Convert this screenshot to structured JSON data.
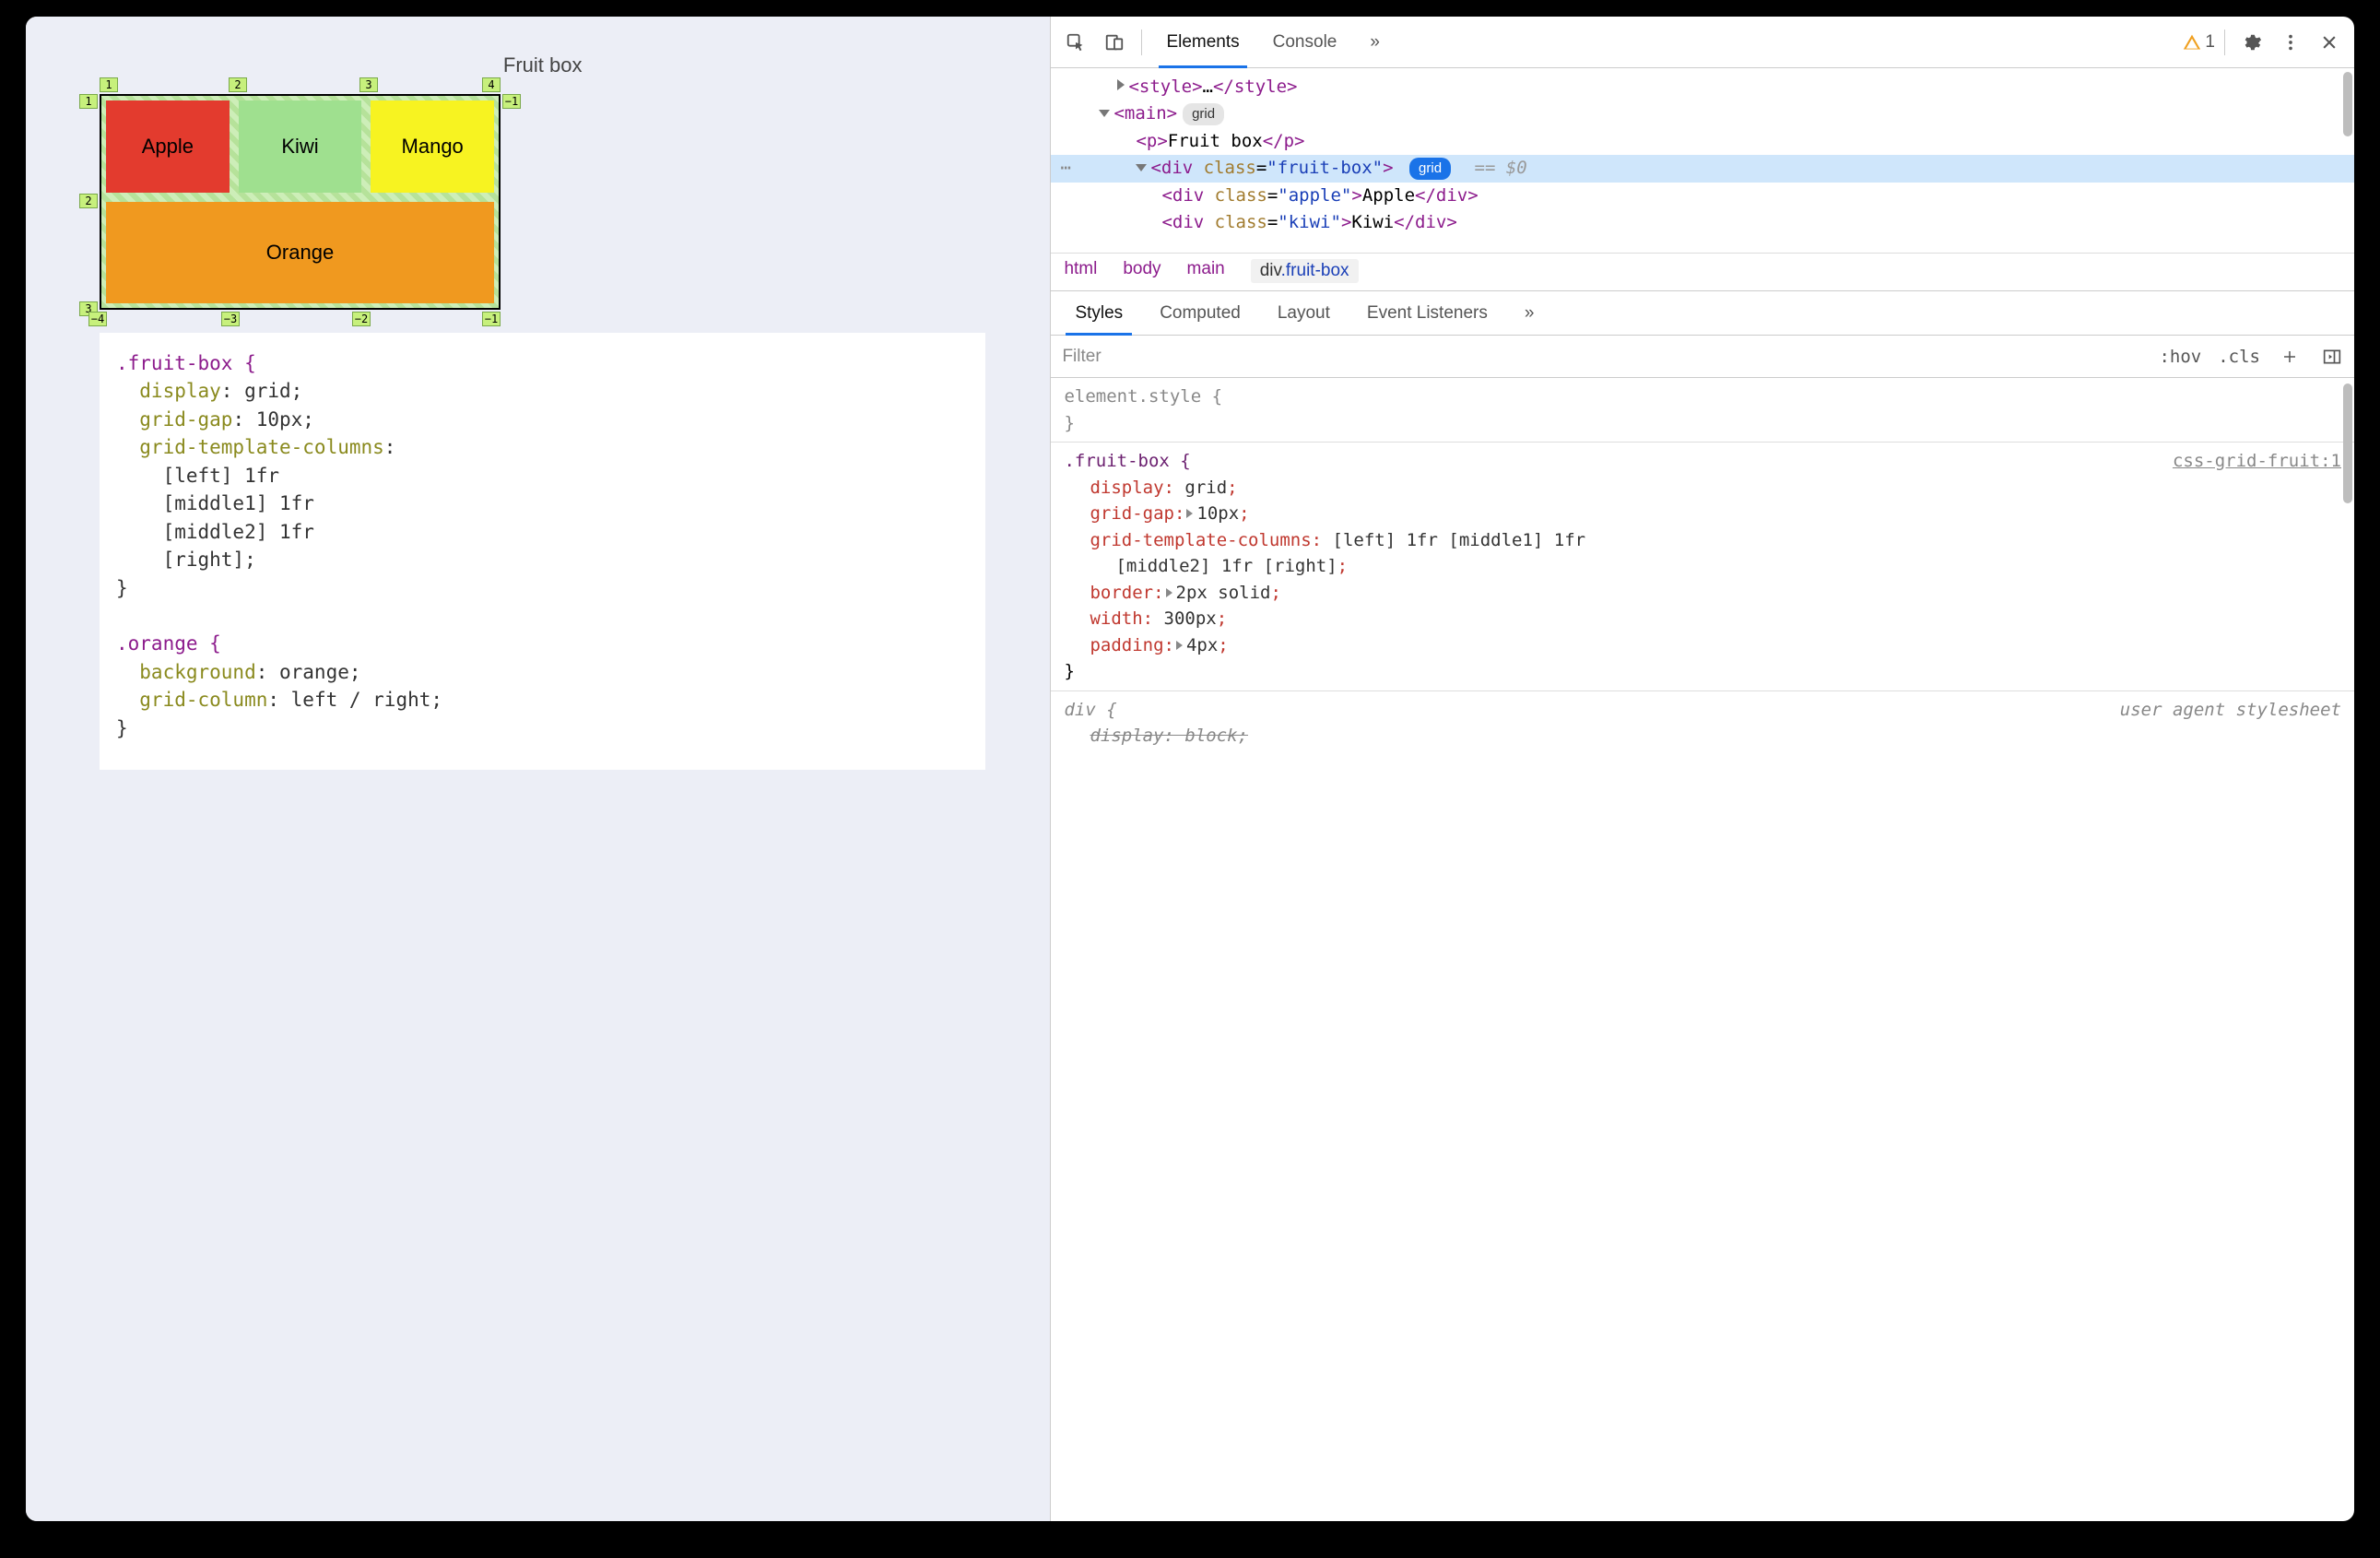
{
  "page": {
    "title": "Fruit box",
    "cells": {
      "apple": "Apple",
      "kiwi": "Kiwi",
      "mango": "Mango",
      "orange": "Orange"
    },
    "grid_labels": {
      "top": [
        "1",
        "2",
        "3",
        "4"
      ],
      "left": [
        "1",
        "2",
        "3"
      ],
      "right_neg": "−1",
      "bottom_neg": [
        "−4",
        "−3",
        "−2",
        "−1"
      ]
    }
  },
  "snippet": {
    "rule1_selector": ".fruit-box {",
    "rule1_lines": [
      "  display: grid;",
      "  grid-gap: 10px;",
      "  grid-template-columns:",
      "    [left] 1fr",
      "    [middle1] 1fr",
      "    [middle2] 1fr",
      "    [right];",
      "}"
    ],
    "rule2_selector": ".orange {",
    "rule2_lines": [
      "  background: orange;",
      "  grid-column: left / right;",
      "}"
    ]
  },
  "devtools": {
    "tabs": {
      "elements": "Elements",
      "console": "Console",
      "more": "»"
    },
    "warn_count": "1",
    "dom": {
      "line1": "<style>…</style>",
      "line2_tag": "main",
      "line2_badge": "grid",
      "line3": "<p>Fruit box</p>",
      "line4_open": "<div class=\"fruit-box\">",
      "line4_badge": "grid",
      "line4_suffix": "== $0",
      "line5": "<div class=\"apple\">Apple</div>",
      "line6": "<div class=\"kiwi\">Kiwi</div>"
    },
    "crumbs": [
      "html",
      "body",
      "main",
      "div.fruit-box"
    ],
    "subtabs": [
      "Styles",
      "Computed",
      "Layout",
      "Event Listeners",
      "»"
    ],
    "filter_placeholder": "Filter",
    "filter_segs": {
      "hov": ":hov",
      "cls": ".cls"
    },
    "styles": {
      "element_style": "element.style {",
      "close": "}",
      "rule_selector": ".fruit-box {",
      "rule_source": "css-grid-fruit:1",
      "props": [
        {
          "name": "display",
          "val": "grid",
          "expand": false
        },
        {
          "name": "grid-gap",
          "val": "10px",
          "expand": true
        },
        {
          "name": "grid-template-columns",
          "val": "[left] 1fr [middle1] 1fr",
          "expand": false
        },
        {
          "name_cont": "",
          "val_cont": "[middle2] 1fr [right]"
        },
        {
          "name": "border",
          "val": "2px solid",
          "expand": true
        },
        {
          "name": "width",
          "val": "300px",
          "expand": false
        },
        {
          "name": "padding",
          "val": "4px",
          "expand": true
        }
      ],
      "ua_label": "user agent stylesheet",
      "ua_selector": "div {",
      "ua_prop": "display: block;"
    }
  }
}
